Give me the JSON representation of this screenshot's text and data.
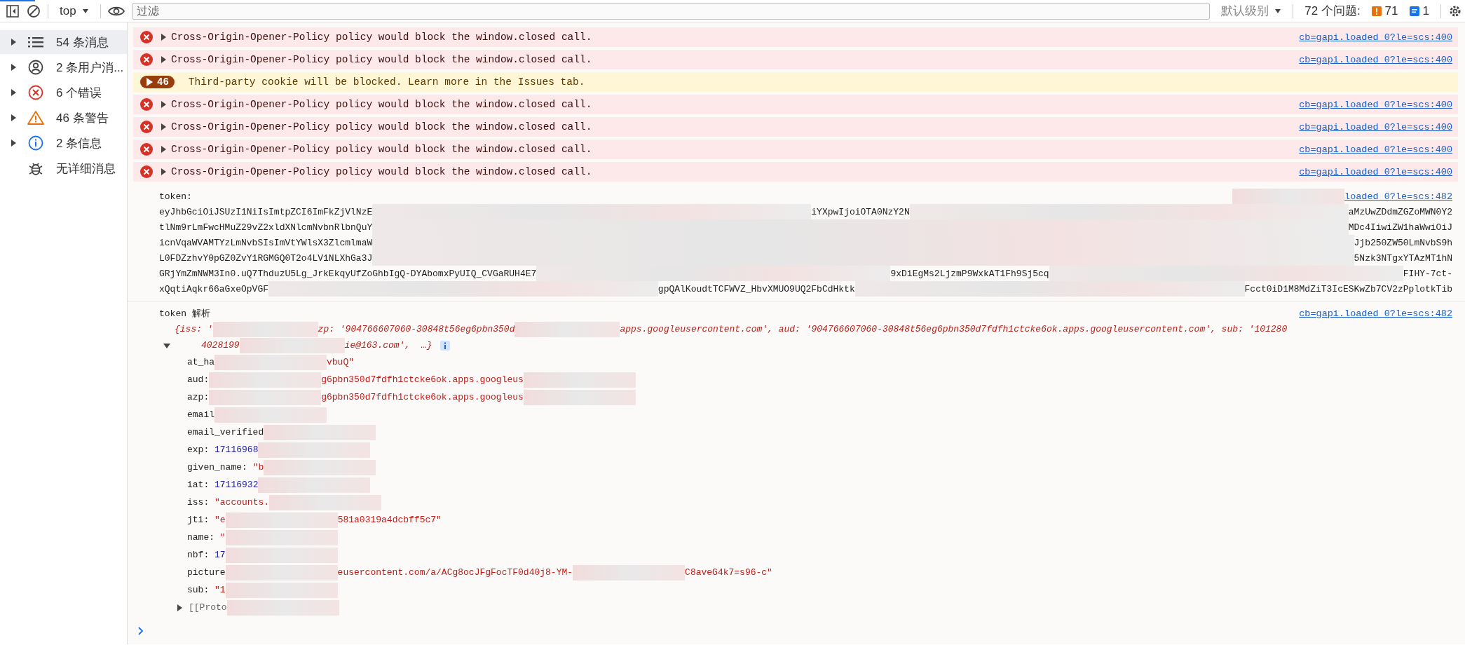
{
  "toolbar": {
    "context": "top",
    "filter_placeholder": "过滤",
    "level_menu": "默认级别",
    "issues_label": "72 个问题:",
    "issue_counts": [
      {
        "kind": "warning",
        "count": "71"
      },
      {
        "kind": "info",
        "count": "1"
      }
    ]
  },
  "sidebar": {
    "items": [
      {
        "label": "54 条消息",
        "selected": true,
        "expandable": true
      },
      {
        "label": "2 条用户消...",
        "selected": false,
        "expandable": true
      },
      {
        "label": "6 个错误",
        "selected": false,
        "expandable": true
      },
      {
        "label": "46 条警告",
        "selected": false,
        "expandable": true
      },
      {
        "label": "2 条信息",
        "selected": false,
        "expandable": true
      },
      {
        "label": "无详细消息",
        "selected": false,
        "expandable": false
      }
    ]
  },
  "messages": [
    {
      "kind": "error",
      "text": "Cross-Origin-Opener-Policy policy would block the window.closed call.",
      "source": "cb=gapi.loaded_0?le=scs:400"
    },
    {
      "kind": "error",
      "text": "Cross-Origin-Opener-Policy policy would block the window.closed call.",
      "source": "cb=gapi.loaded_0?le=scs:400"
    },
    {
      "kind": "issue",
      "count": "46",
      "text": "Third-party cookie will be blocked. Learn more in the Issues tab."
    },
    {
      "kind": "error",
      "text": "Cross-Origin-Opener-Policy policy would block the window.closed call.",
      "source": "cb=gapi.loaded_0?le=scs:400"
    },
    {
      "kind": "error",
      "text": "Cross-Origin-Opener-Policy policy would block the window.closed call.",
      "source": "cb=gapi.loaded_0?le=scs:400"
    },
    {
      "kind": "error",
      "text": "Cross-Origin-Opener-Policy policy would block the window.closed call.",
      "source": "cb=gapi.loaded_0?le=scs:400"
    },
    {
      "kind": "error",
      "text": "Cross-Origin-Opener-Policy policy would block the window.closed call.",
      "source": "cb=gapi.loaded_0?le=scs:400"
    }
  ],
  "token_log": {
    "label": "token:",
    "source": "loaded_0?le=scs:482",
    "lines": [
      {
        "parts": [
          "eyJhbGciOiJSUzI1NiIsImtpZCI6ImFkZjVlNzE",
          "iYXpwIjoiOTA0NzY2N",
          "aMzUwZDdmZGZoMWN0Y2"
        ]
      },
      {
        "parts": [
          "tlNm9rLmFwcHMuZ29vZ2xldXNlcmNvbnRlbnQuY",
          "MDc4IiwiZW1haWwiOiJ"
        ]
      },
      {
        "parts": [
          "icnVqaWVAMTYzLmNvbSIsImVtYWlsX3ZlcmlmaW",
          "Jjb250ZW50LmNvbS9h"
        ]
      },
      {
        "parts": [
          "L0FDZzhvY0pGZ0ZvY1RGMGQ0T2o4LV1NLXhGa3J",
          "5Nzk3NTgxYTAzMT1hN"
        ]
      },
      {
        "parts": [
          "GRjYmZmNWM3In0.uQ7ThduzU5Lg_JrkEkqyUfZoGhbIgQ-DYAbomxPyUIQ_CVGaRUH4E7",
          "9xDiEgMs2LjzmP9WxkAT1Fh9Sj5cq",
          "FIHY-7ct-"
        ]
      },
      {
        "parts": [
          "xQqtiAqkr66aGxeOpVGF",
          "gpQAlKoudtTCFWVZ_HbvXMUO9UQ2FbCdHktk",
          "Fcct0iD1M8MdZiT3IcESKwZb7CV2zPplotkTib"
        ]
      }
    ]
  },
  "parsed_log": {
    "label": "token 解析",
    "source": "cb=gapi.loaded_0?le=scs:482",
    "expanded": true,
    "summary": [
      {
        "parts": [
          "{iss: '",
          "zp: '904766607060-30848t56eg6pbn350d",
          "apps.googleusercontent.com', aud: '904766607060-30848t56eg6pbn350d7fdfh1ctcke6ok.apps.googleusercontent.com', sub: '101280"
        ]
      },
      {
        "parts": [
          "4028199",
          "ie@163.com',  …}"
        ]
      }
    ],
    "properties": [
      {
        "key": "at_ha",
        "kind": "string",
        "parts": [
          "vbuQ\""
        ],
        "blur_before": true,
        "blur_after": false
      },
      {
        "key": "aud:",
        "kind": "string",
        "parts": [
          "g6pbn350d7fdfh1ctcke6ok.apps.googleus"
        ],
        "blur_before": true,
        "blur_after": true
      },
      {
        "key": "azp:",
        "kind": "string",
        "parts": [
          "g6pbn350d7fdfh1ctcke6ok.apps.googleus"
        ],
        "blur_before": true,
        "blur_after": true
      },
      {
        "key": "email",
        "kind": "string",
        "blur_before": true,
        "blur_after": false
      },
      {
        "key": "email_verified",
        "kind": "string",
        "blur_before": true,
        "blur_after": false
      },
      {
        "key": "exp:",
        "kind": "number",
        "parts": [
          "17116968"
        ],
        "blur_before": false,
        "blur_after": true
      },
      {
        "key": "given_name:",
        "kind": "string",
        "parts": [
          "\"b"
        ],
        "blur_before": false,
        "blur_after": true
      },
      {
        "key": "iat:",
        "kind": "number",
        "parts": [
          "17116932"
        ],
        "blur_before": false,
        "blur_after": true
      },
      {
        "key": "iss:",
        "kind": "string",
        "parts": [
          "\"accounts."
        ],
        "blur_before": false,
        "blur_after": true
      },
      {
        "key": "jti:",
        "kind": "string",
        "parts": [
          "\"e",
          "581a0319a4dcbff5c7\""
        ],
        "blur_before": false,
        "blur_after": false
      },
      {
        "key": "name:",
        "kind": "string",
        "parts": [
          "\""
        ],
        "blur_before": false,
        "blur_after": true
      },
      {
        "key": "nbf:",
        "kind": "number",
        "parts": [
          "17"
        ],
        "blur_before": false,
        "blur_after": true
      },
      {
        "key": "picture",
        "kind": "string",
        "parts": [
          "eusercontent.com/a/ACg8ocJFgFocTF0d40j8-YM-",
          "C8aveG4k7=s96-c\""
        ],
        "blur_before": true,
        "blur_after": false
      },
      {
        "key": "sub:",
        "kind": "string",
        "parts": [
          "\"1"
        ],
        "blur_before": false,
        "blur_after": true
      }
    ],
    "prototype": {
      "label": "[[Proto",
      "expanded": false
    }
  }
}
